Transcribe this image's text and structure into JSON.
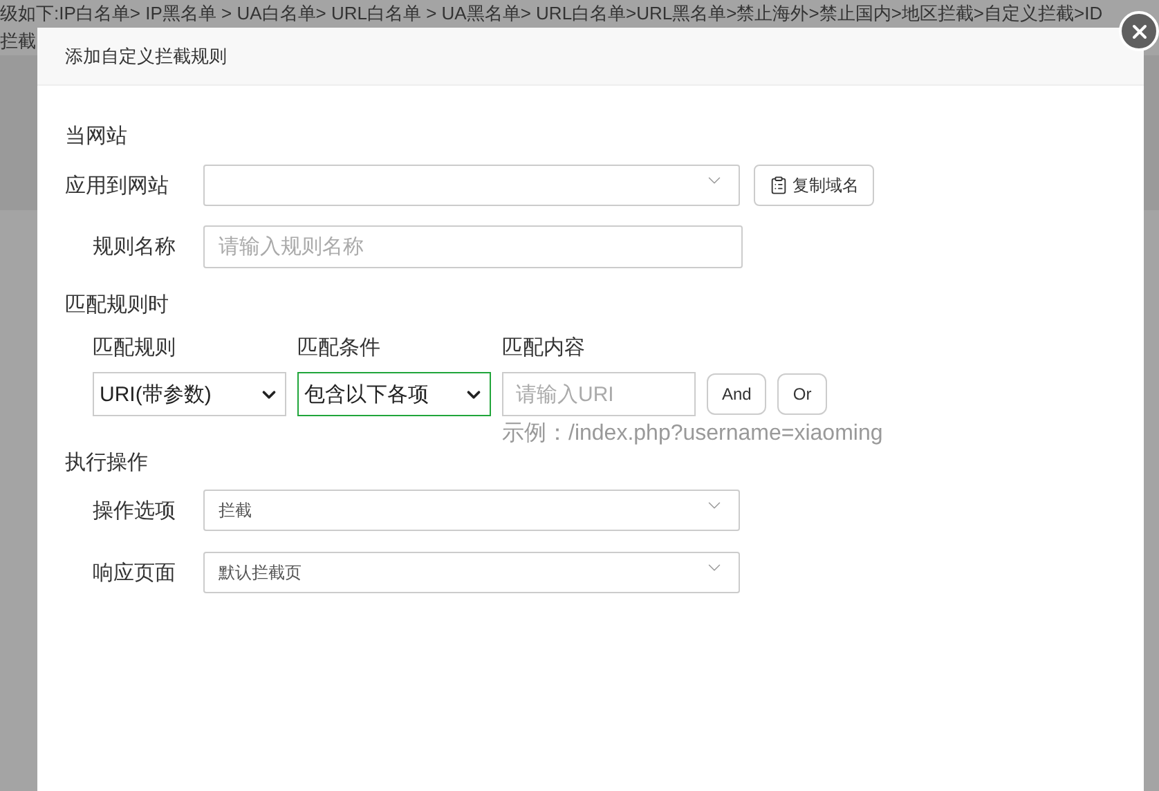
{
  "background": {
    "breadcrumb": "级如下:IP白名单> IP黑名单 > UA白名单> URL白名单 > UA黑名单> URL白名单>URL黑名单>禁止海外>禁止国内>地区拦截>自定义拦截>ID",
    "line_2": "拦截"
  },
  "dialog": {
    "title": "添加自定义拦截规则",
    "site_section": {
      "heading": "当网站",
      "site_label": "应用到网站",
      "copy_button": "复制域名",
      "name_label": "规则名称",
      "name_placeholder": "请输入规则名称"
    },
    "match_section": {
      "heading": "匹配规则时",
      "columns": [
        "匹配规则",
        "匹配条件",
        "匹配内容"
      ],
      "rule_value": "URI(带参数)",
      "condition": {
        "value": "包含以下各项",
        "focused": true
      },
      "content_placeholder": "请输入URI",
      "buttons": [
        "And",
        "Or"
      ],
      "example": "示例：/index.php?username=xiaoming"
    },
    "action_section": {
      "heading": "执行操作",
      "fields": [
        {
          "label": "操作选项",
          "value": "拦截"
        },
        {
          "label": "响应页面",
          "value": "默认拦截页"
        }
      ]
    }
  }
}
